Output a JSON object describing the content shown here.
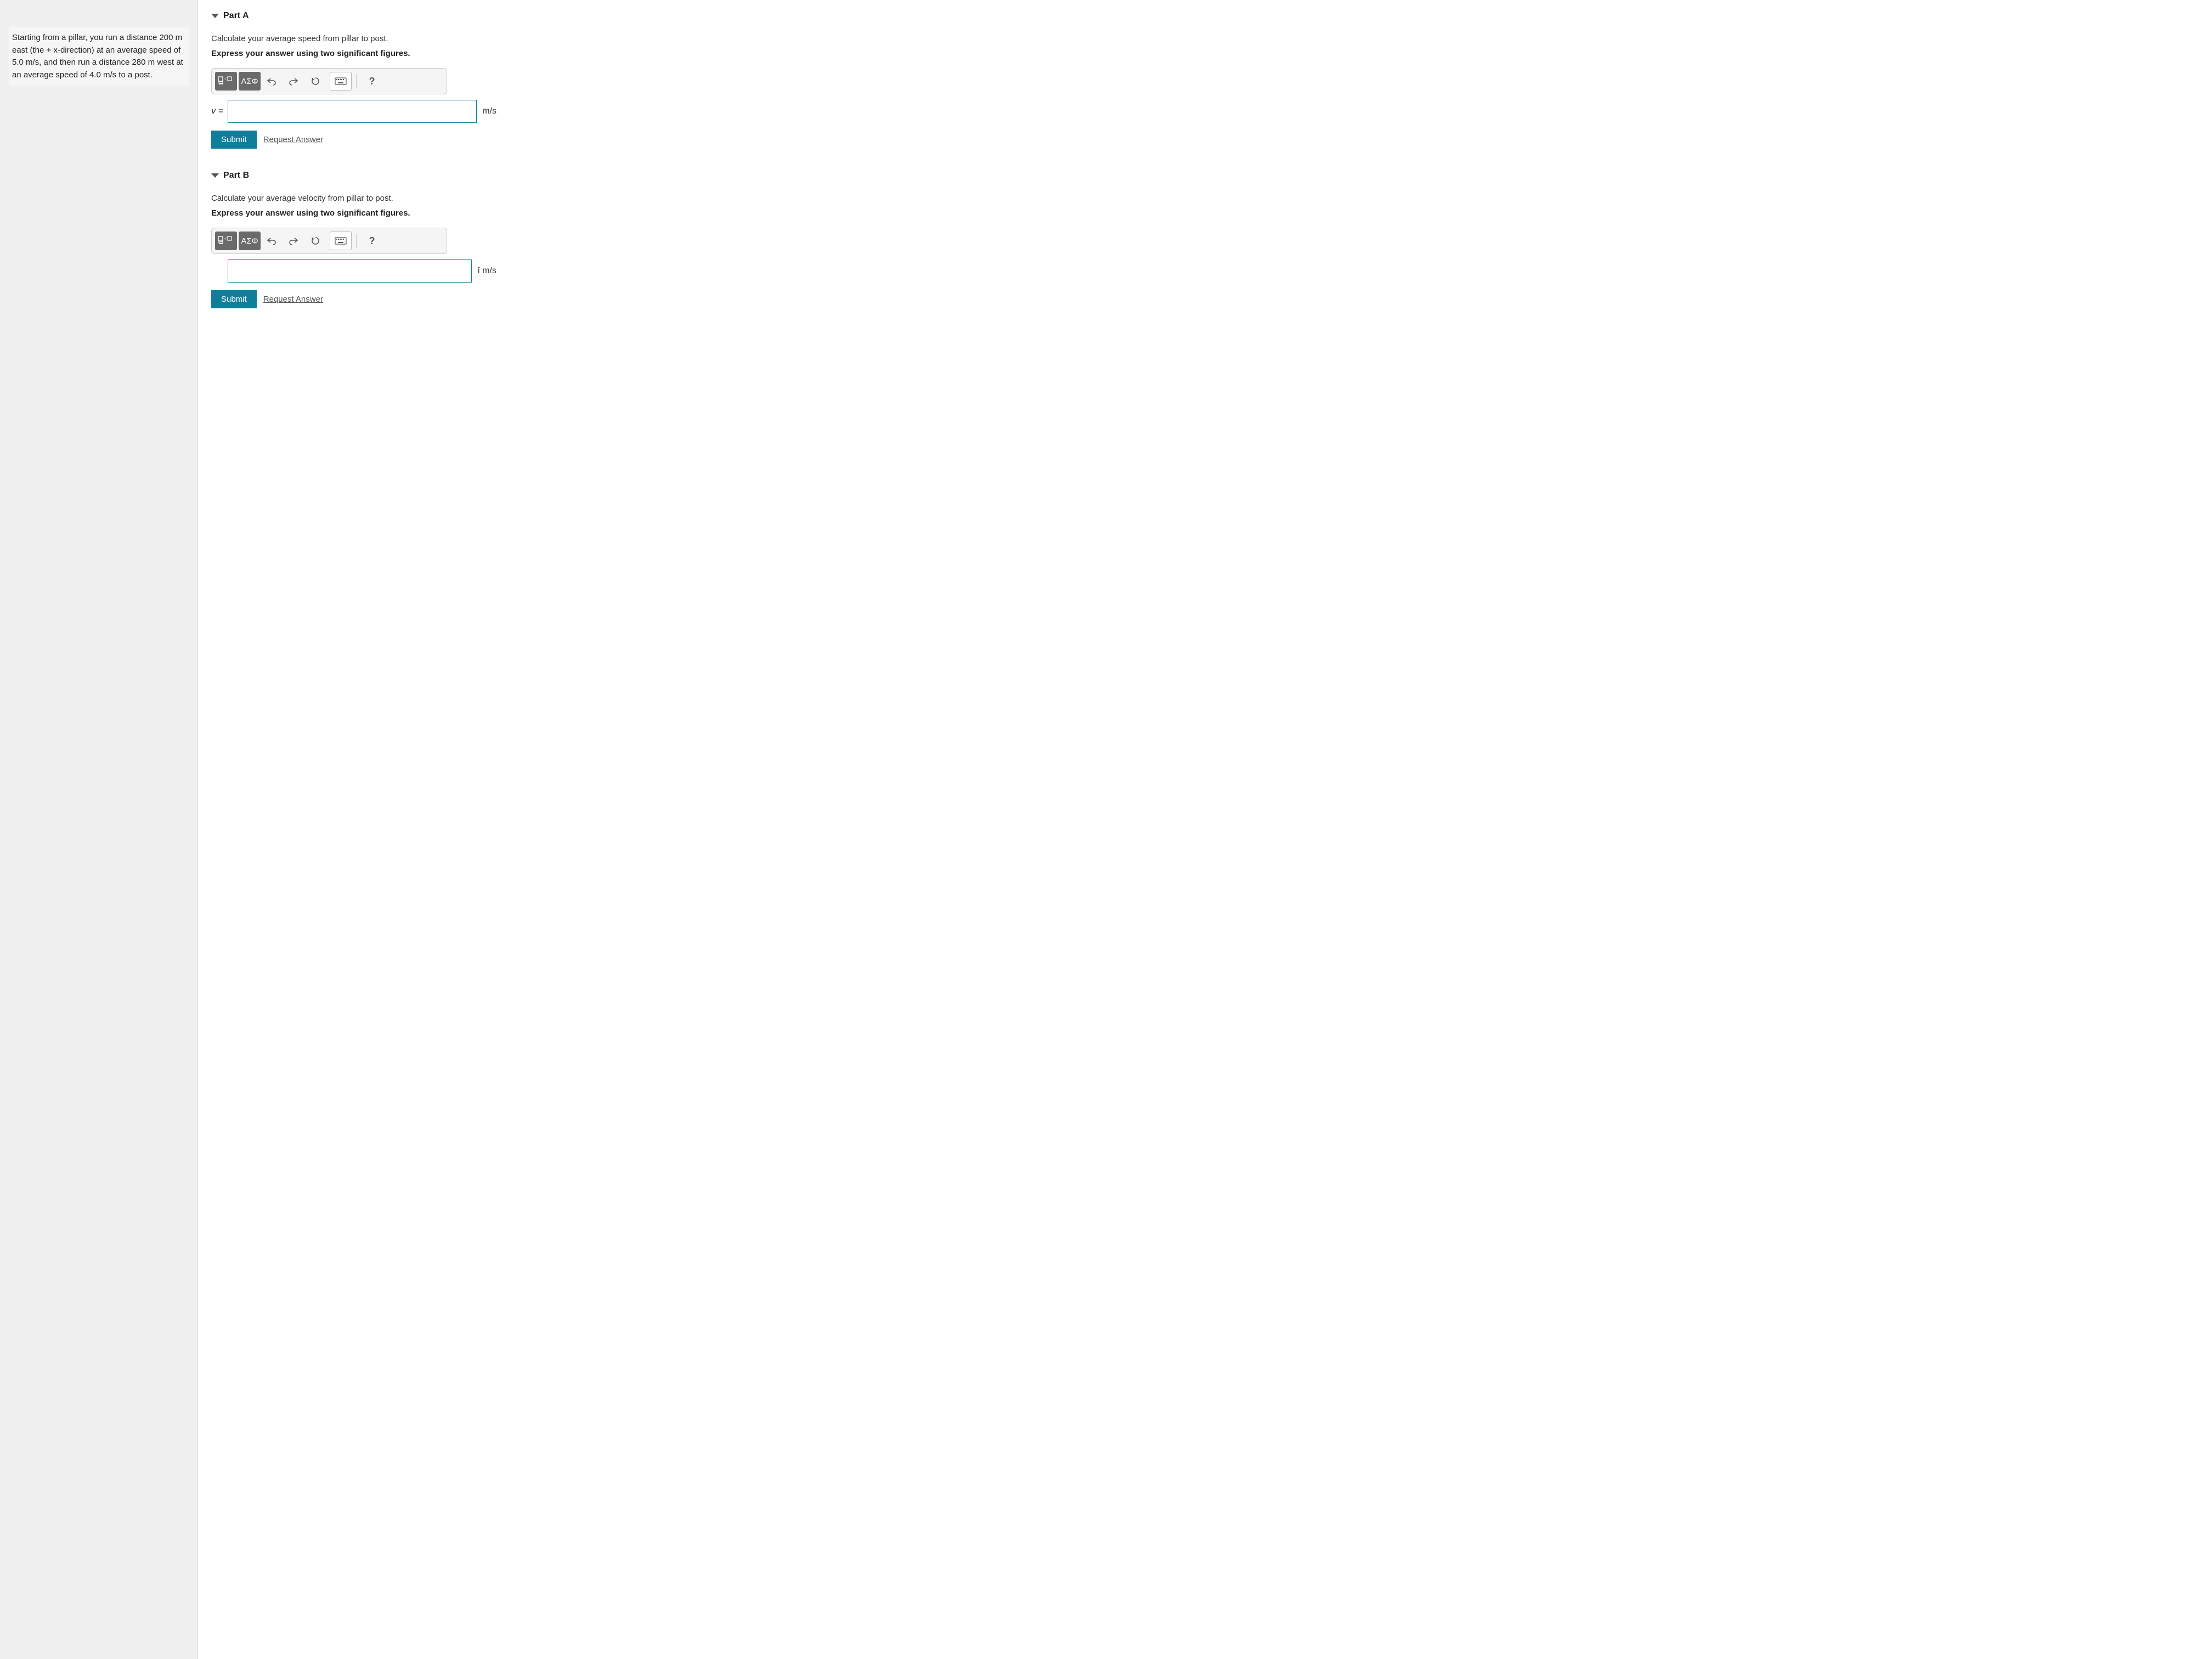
{
  "problem": {
    "text": "Starting from a pillar, you run a distance 200 m east (the + x-direction) at an average speed of 5.0 m/s, and then run a distance 280 m west at an average speed of 4.0 m/s to a post."
  },
  "toolbar": {
    "templates_label": "templates",
    "symbols_label": "ΑΣΦ",
    "undo": "undo",
    "redo": "redo",
    "reset": "reset",
    "keyboard": "keyboard",
    "help": "?"
  },
  "buttons": {
    "submit": "Submit",
    "request": "Request Answer"
  },
  "partA": {
    "title": "Part A",
    "question": "Calculate your average speed from pillar to post.",
    "instruction": "Express your answer using two significant figures.",
    "var": "v =",
    "value": "",
    "unit": "m/s"
  },
  "partB": {
    "title": "Part B",
    "question": "Calculate your average velocity from pillar to post.",
    "instruction": "Express your answer using two significant figures.",
    "value": "",
    "unit_prefix": "î ",
    "unit": "m/s"
  }
}
